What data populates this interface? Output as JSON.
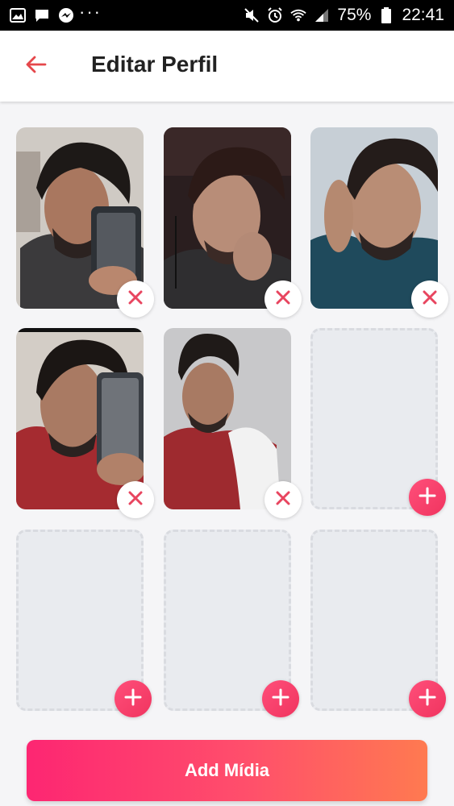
{
  "status_bar": {
    "battery_percent": "75%",
    "time": "22:41",
    "left_icons": [
      "image-icon",
      "message-icon",
      "messenger-icon",
      "more-dots-icon"
    ],
    "right_icons": [
      "mute-icon",
      "alarm-icon",
      "wifi-icon",
      "signal-icon",
      "battery-icon"
    ]
  },
  "header": {
    "title": "Editar Perfil",
    "back_icon": "arrow-left-icon",
    "accent_color": "#e5474b"
  },
  "media_slots": [
    {
      "kind": "photo",
      "action": "remove"
    },
    {
      "kind": "photo",
      "action": "remove"
    },
    {
      "kind": "photo",
      "action": "remove"
    },
    {
      "kind": "photo",
      "action": "remove"
    },
    {
      "kind": "photo",
      "action": "remove"
    },
    {
      "kind": "empty",
      "action": "add"
    },
    {
      "kind": "empty",
      "action": "add"
    },
    {
      "kind": "empty",
      "action": "add"
    },
    {
      "kind": "empty",
      "action": "add"
    }
  ],
  "actions": {
    "add_media_label": "Add Mídia",
    "remove_icon": "close-icon",
    "add_icon": "plus-icon",
    "remove_color": "#e8455f",
    "add_gradient": [
      "#fd2672",
      "#ff7a50"
    ]
  }
}
